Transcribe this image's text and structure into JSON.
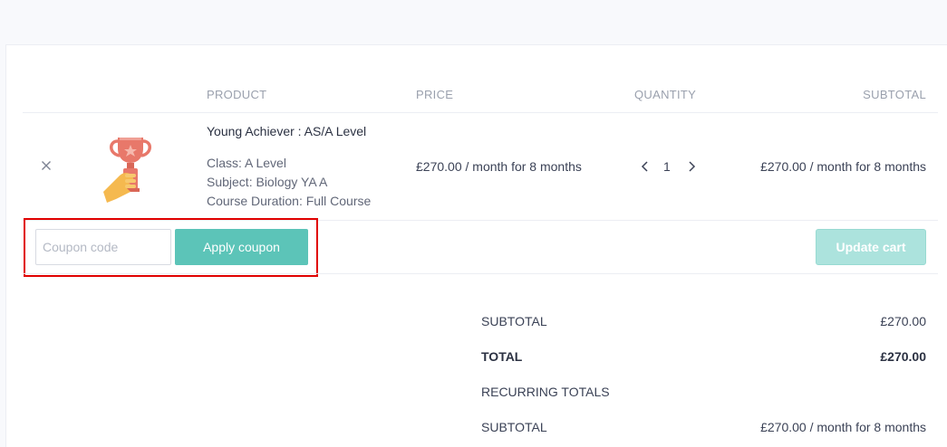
{
  "table": {
    "headers": {
      "product": "PRODUCT",
      "price": "PRICE",
      "quantity": "QUANTITY",
      "subtotal": "SUBTOTAL"
    },
    "item": {
      "remove_label": "×",
      "title": "Young Achiever : AS/A Level",
      "meta": [
        "Class: A Level",
        "Subject: Biology YA A",
        "Course Duration: Full Course"
      ],
      "price": "£270.00 / month for 8 months",
      "quantity": "1",
      "subtotal": "£270.00 / month for 8 months",
      "image_icon": "trophy-hand-icon"
    }
  },
  "coupon": {
    "placeholder": "Coupon code",
    "value": "",
    "apply_label": "Apply coupon"
  },
  "update_cart_label": "Update cart",
  "totals": {
    "subtotal_label": "SUBTOTAL",
    "subtotal_value": "£270.00",
    "total_label": "TOTAL",
    "total_value": "£270.00",
    "recurring_label": "RECURRING TOTALS",
    "recurring_subtotal_label": "SUBTOTAL",
    "recurring_subtotal_value": "£270.00 / month for 8 months"
  },
  "colors": {
    "accent": "#5cc4b8",
    "accent_disabled": "#ace3dd",
    "highlight": "#e00000",
    "trophy": "#e8786a",
    "hand": "#f5b94f"
  }
}
